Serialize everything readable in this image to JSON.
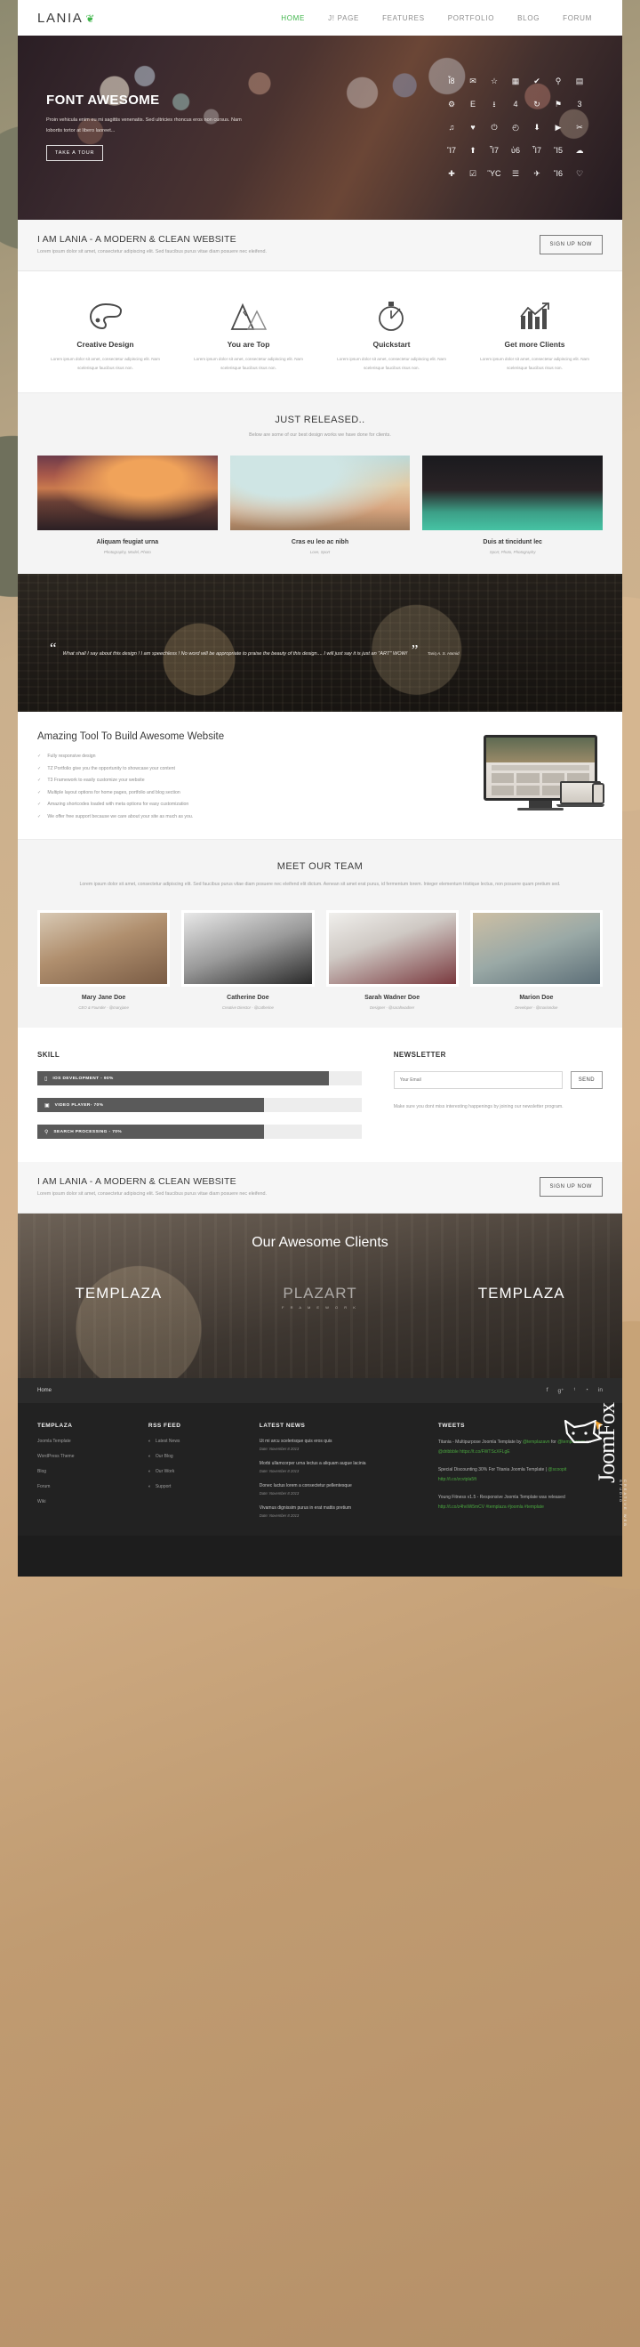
{
  "header": {
    "brand": "LANIA",
    "brand_icon": "leaf-icon",
    "nav": [
      {
        "label": "HOME",
        "active": true
      },
      {
        "label": "J! PAGE",
        "active": false
      },
      {
        "label": "FEATURES",
        "active": false
      },
      {
        "label": "PORTFOLIO",
        "active": false
      },
      {
        "label": "BLOG",
        "active": false
      },
      {
        "label": "FORUM",
        "active": false
      }
    ]
  },
  "hero": {
    "title": "FONT AWESOME",
    "paragraph": "Proin vehicula enim eu mi sagittis venenatis. Sed ultricies rhoncus eros non cursus. Nam lobortis tortor at libero laoreet...",
    "button": "TAKE A TOUR",
    "icons": [
      {
        "name": "glass-icon",
        "glyph": "ἷ8"
      },
      {
        "name": "envelope-icon",
        "glyph": "✉"
      },
      {
        "name": "star-icon",
        "glyph": "☆"
      },
      {
        "name": "th-large-icon",
        "glyph": "▦"
      },
      {
        "name": "check-icon",
        "glyph": "✔"
      },
      {
        "name": "search-icon",
        "glyph": "⚲"
      },
      {
        "name": "credit-card-icon",
        "glyph": "▤"
      },
      {
        "name": "gear-icon",
        "glyph": "⚙"
      },
      {
        "name": "file-icon",
        "glyph": "὜E"
      },
      {
        "name": "download-icon",
        "glyph": "⭳"
      },
      {
        "name": "inbox-icon",
        "glyph": "὜4"
      },
      {
        "name": "refresh-icon",
        "glyph": "↻"
      },
      {
        "name": "flag-icon",
        "glyph": "⚑"
      },
      {
        "name": "bullhorn-icon",
        "glyph": "὎3"
      },
      {
        "name": "music-icon",
        "glyph": "♫"
      },
      {
        "name": "heart-icon",
        "glyph": "♥"
      },
      {
        "name": "power-off-icon",
        "glyph": "⏻"
      },
      {
        "name": "clock-icon",
        "glyph": "◴"
      },
      {
        "name": "arrow-circle-down-icon",
        "glyph": "⬇"
      },
      {
        "name": "play-circle-icon",
        "glyph": "▶"
      },
      {
        "name": "scissors-icon",
        "glyph": "✂"
      },
      {
        "name": "headphones-icon",
        "glyph": "Ἲ7"
      },
      {
        "name": "arrow-circle-up-icon",
        "glyph": "⬆"
      },
      {
        "name": "tag-icon",
        "glyph": "Ἷ7"
      },
      {
        "name": "bookmark-icon",
        "glyph": "ὑ6"
      },
      {
        "name": "tags-icon",
        "glyph": "Ἷ7"
      },
      {
        "name": "video-camera-icon",
        "glyph": "Ἲ5"
      },
      {
        "name": "cloud-icon",
        "glyph": "☁"
      },
      {
        "name": "arrows-move-icon",
        "glyph": "✚"
      },
      {
        "name": "check-square-icon",
        "glyph": "☑"
      },
      {
        "name": "image-icon",
        "glyph": "ὛC"
      },
      {
        "name": "list-icon",
        "glyph": "☰"
      },
      {
        "name": "plane-icon",
        "glyph": "✈"
      },
      {
        "name": "trophy-icon",
        "glyph": "Ἴ6"
      },
      {
        "name": "heart-outline-icon",
        "glyph": "♡"
      }
    ]
  },
  "signup_top": {
    "title": "I AM LANIA - A MODERN & CLEAN WEBSITE",
    "subtitle": "Lorem ipsum dolor sit amet, consectetur adipiscing elit. Sed faucibus purus vitae diam posuere nec eleifend.",
    "button": "SIGN UP NOW"
  },
  "signup_bottom": {
    "title": "I AM LANIA - A MODERN & CLEAN WEBSITE",
    "subtitle": "Lorem ipsum dolor sit amet, consectetur adipiscing elit. Sed faucibus purus vitae diam posuere nec eleifend.",
    "button": "SIGN UP NOW"
  },
  "features": [
    {
      "icon": "palette-icon",
      "title": "Creative Design",
      "text": "Lorem ipsum dolor sit amet, consectetur adipiscing elit. Nam scelerisque faucibus risus non."
    },
    {
      "icon": "mountains-icon",
      "title": "You are Top",
      "text": "Lorem ipsum dolor sit amet, consectetur adipiscing elit. Nam scelerisque faucibus risus non."
    },
    {
      "icon": "stopwatch-icon",
      "title": "Quickstart",
      "text": "Lorem ipsum dolor sit amet, consectetur adipiscing elit. Nam scelerisque faucibus risus non."
    },
    {
      "icon": "bar-chart-growth-icon",
      "title": "Get more Clients",
      "text": "Lorem ipsum dolor sit amet, consectetur adipiscing elit. Nam scelerisque faucibus risus non."
    }
  ],
  "portfolio": {
    "title": "JUST RELEASED..",
    "subtitle": "Below are some of our best design works we have done for clients.",
    "items": [
      {
        "title": "Aliquam feugiat urna",
        "categories": "Photography, Model, Photo"
      },
      {
        "title": "Cras eu leo ac nibh",
        "categories": "Love, Sport"
      },
      {
        "title": "Duis at tincidunt lec",
        "categories": "Sport, Photo, Photography"
      }
    ]
  },
  "testimonial": {
    "quote": "What shall I say about this design ! I am speechless ! No word will be appropriate to praise the beauty of this design.... I will just say it is just an \"ART\" WOW!",
    "author": "Tariq A. S. Hamid",
    "open_mark": "“",
    "close_mark": "”"
  },
  "amazing": {
    "title": "Amazing Tool To Build Awesome Website",
    "check": "✓",
    "items": [
      "Fully responsive design",
      "TZ Portfolio give you the opportunity to showcase your content",
      "T3 Framework to easily customize your website",
      "Multiple layout options for home pages, portfolio and blog section",
      "Amazing shortcodes loaded with meta options for easy customization",
      "We offer free support because we care about your site as much as you."
    ]
  },
  "team": {
    "title": "MEET OUR TEAM",
    "copy": "Lorem ipsum dolor sit amet, consectetur adipiscing elit. Sed faucibus purus vitae diam posuere nec eleifend elit dictum. Aenean sit amet erat purus, id fermentum lorem. Integer elementum tristique lectus, non posuere quam pretium sed.",
    "members": [
      {
        "name": "Mary Jane Doe",
        "role": "CEO & Founder - @maryjane"
      },
      {
        "name": "Catherine Doe",
        "role": "Creative Director - @catherine"
      },
      {
        "name": "Sarah Wadner Doe",
        "role": "Designer - @sarahwadner"
      },
      {
        "name": "Marion Doe",
        "role": "Developer - @mariondoe"
      }
    ]
  },
  "skill": {
    "title": "SKILL",
    "bars": [
      {
        "icon": "mobile-icon",
        "glyph": "▯",
        "label": "IOS DEVELOPMENT - 90%",
        "percent": 90
      },
      {
        "icon": "film-icon",
        "glyph": "▣",
        "label": "VIDEO PLAYER- 70%",
        "percent": 70
      },
      {
        "icon": "search-icon",
        "glyph": "⚲",
        "label": "SEARCH PROCESSING - 70%",
        "percent": 70
      }
    ]
  },
  "newsletter": {
    "title": "NEWSLETTER",
    "placeholder": "Your Email",
    "value": "",
    "send_label": "SEND",
    "copy": "Make sure you dont miss interesting happenings by joining our newsletter program."
  },
  "clients": {
    "title": "Our Awesome Clients",
    "logos": [
      {
        "name": "TEMPLAZA",
        "sub": "",
        "dim": false
      },
      {
        "name": "PLAZART",
        "sub": "F R A M E W O R K",
        "dim": true
      },
      {
        "name": "TEMPLAZA",
        "sub": "",
        "dim": false
      }
    ]
  },
  "foot_top": {
    "home": "Home",
    "socials": [
      {
        "name": "facebook-icon",
        "glyph": "f"
      },
      {
        "name": "googleplus-icon",
        "glyph": "g⁺"
      },
      {
        "name": "twitter-icon",
        "glyph": "ᵗ"
      },
      {
        "name": "rss-icon",
        "glyph": "◔"
      },
      {
        "name": "linkedin-icon",
        "glyph": "in"
      }
    ]
  },
  "footer": {
    "columns": [
      {
        "title": "TEMPLAZA",
        "links": [
          "Joomla Template",
          "WordPress Theme",
          "Blog",
          "Forum",
          "Wiki"
        ]
      },
      {
        "title": "RSS FEED",
        "links": [
          "Latest News",
          "Our Blog",
          "Our Work",
          "Support"
        ],
        "rss": true
      }
    ],
    "latest_news": {
      "title": "LATEST NEWS",
      "items": [
        {
          "text": "Ut mi arcu scelerisque quis eros quis",
          "date": "Date: November 8 2013"
        },
        {
          "text": "Morbi ullamcorper urna lectus a aliquam augue lacinia",
          "date": "Date: November 8 2013"
        },
        {
          "text": "Donec luctus lorem a consectetur pellentesque",
          "date": "Date: November 8 2013"
        },
        {
          "text": "Vivamus dignissim purus in erat mattis pretium",
          "date": "Date: November 8 2013"
        }
      ]
    },
    "tweets": {
      "title": "TWEETS",
      "items": [
        {
          "plain1": "Titania - Multipurpose Joomla Template by ",
          "link1": "@templazavn",
          "plain2": " for ",
          "link2": "@templazavn",
          "plain3": " on ",
          "link3": "@dribbble",
          "plain4": " ",
          "link4": "https://t.co/FWTScXFLgE"
        },
        {
          "plain1": "Special Discounting 30% For Titania Joomla Template | ",
          "link1": "@scoopit",
          "plain2": " ",
          "link2": "http://t.co/zcvtpla5ft",
          "plain3": "",
          "link3": "",
          "plain4": "",
          "link4": ""
        },
        {
          "plain1": "Young Fitness v1.5 - Responsive Joomla Template was released ",
          "link1": "http://t.co/z4hvWi5mCV",
          "plain2": " ",
          "link2": "#templaza",
          "plain3": " ",
          "link3": "#joomla",
          "plain4": " ",
          "link4": "#template"
        }
      ]
    },
    "watermark": {
      "text": "JoomFox",
      "sub": "CREATIVE WEB STUDIO"
    }
  }
}
